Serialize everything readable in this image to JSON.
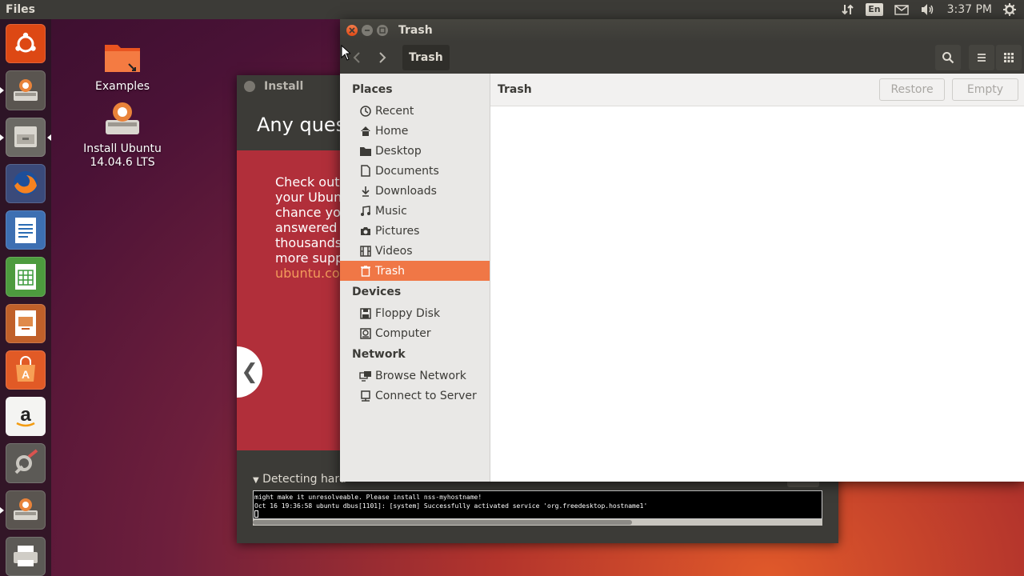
{
  "top_panel": {
    "app_name": "Files",
    "keyboard_layout": "En",
    "clock": "3:37 PM"
  },
  "launcher": {
    "items": [
      {
        "name": "ubuntu-dash",
        "color": "#dd4814"
      },
      {
        "name": "install-ubuntu",
        "color": "#8a8a8a"
      },
      {
        "name": "files",
        "color": "#7a7a7a"
      },
      {
        "name": "firefox",
        "color": "#e66000"
      },
      {
        "name": "libreoffice-writer",
        "color": "#2a6cb4"
      },
      {
        "name": "libreoffice-calc",
        "color": "#3c9a3c"
      },
      {
        "name": "libreoffice-impress",
        "color": "#c85a1e"
      },
      {
        "name": "ubuntu-software",
        "color": "#e95420"
      },
      {
        "name": "amazon",
        "color": "#ffffff"
      },
      {
        "name": "system-settings",
        "color": "#6b6b6b"
      },
      {
        "name": "install-ubuntu-running",
        "color": "#8a8a8a"
      },
      {
        "name": "printer",
        "color": "#8a8a8a"
      }
    ]
  },
  "desktop": {
    "icons": [
      {
        "label": "Examples"
      },
      {
        "label": "Install Ubuntu 14.04.6 LTS"
      }
    ]
  },
  "installer": {
    "title": "Install",
    "heading": "Any quest",
    "body_lines": [
      "Check out a",
      "your Ubunt",
      "chance you",
      "answered a",
      "thousands c",
      "more suppo"
    ],
    "link": "ubuntu.com",
    "detecting": "Detecting hard",
    "terminal_lines": [
      "might make it unresolveable. Please install nss-myhostname!",
      "Oct 16 19:36:58 ubuntu dbus[1101]: [system] Successfully activated service 'org.freedesktop.hostname1'"
    ]
  },
  "files_window": {
    "title": "Trash",
    "path_button": "Trash",
    "main_title": "Trash",
    "restore_label": "Restore",
    "empty_label": "Empty",
    "sidebar": {
      "places_header": "Places",
      "places": [
        {
          "label": "Recent",
          "icon": "clock-icon"
        },
        {
          "label": "Home",
          "icon": "home-icon"
        },
        {
          "label": "Desktop",
          "icon": "folder-icon"
        },
        {
          "label": "Documents",
          "icon": "document-icon"
        },
        {
          "label": "Downloads",
          "icon": "download-icon"
        },
        {
          "label": "Music",
          "icon": "music-icon"
        },
        {
          "label": "Pictures",
          "icon": "camera-icon"
        },
        {
          "label": "Videos",
          "icon": "film-icon"
        },
        {
          "label": "Trash",
          "icon": "trash-icon",
          "active": true
        }
      ],
      "devices_header": "Devices",
      "devices": [
        {
          "label": "Floppy Disk",
          "icon": "floppy-icon"
        },
        {
          "label": "Computer",
          "icon": "harddisk-icon"
        }
      ],
      "network_header": "Network",
      "network": [
        {
          "label": "Browse Network",
          "icon": "network-icon"
        },
        {
          "label": "Connect to Server",
          "icon": "server-icon"
        }
      ]
    }
  },
  "colors": {
    "accent": "#f07746",
    "panel": "#3c3b37",
    "close_button": "#df4a16"
  }
}
